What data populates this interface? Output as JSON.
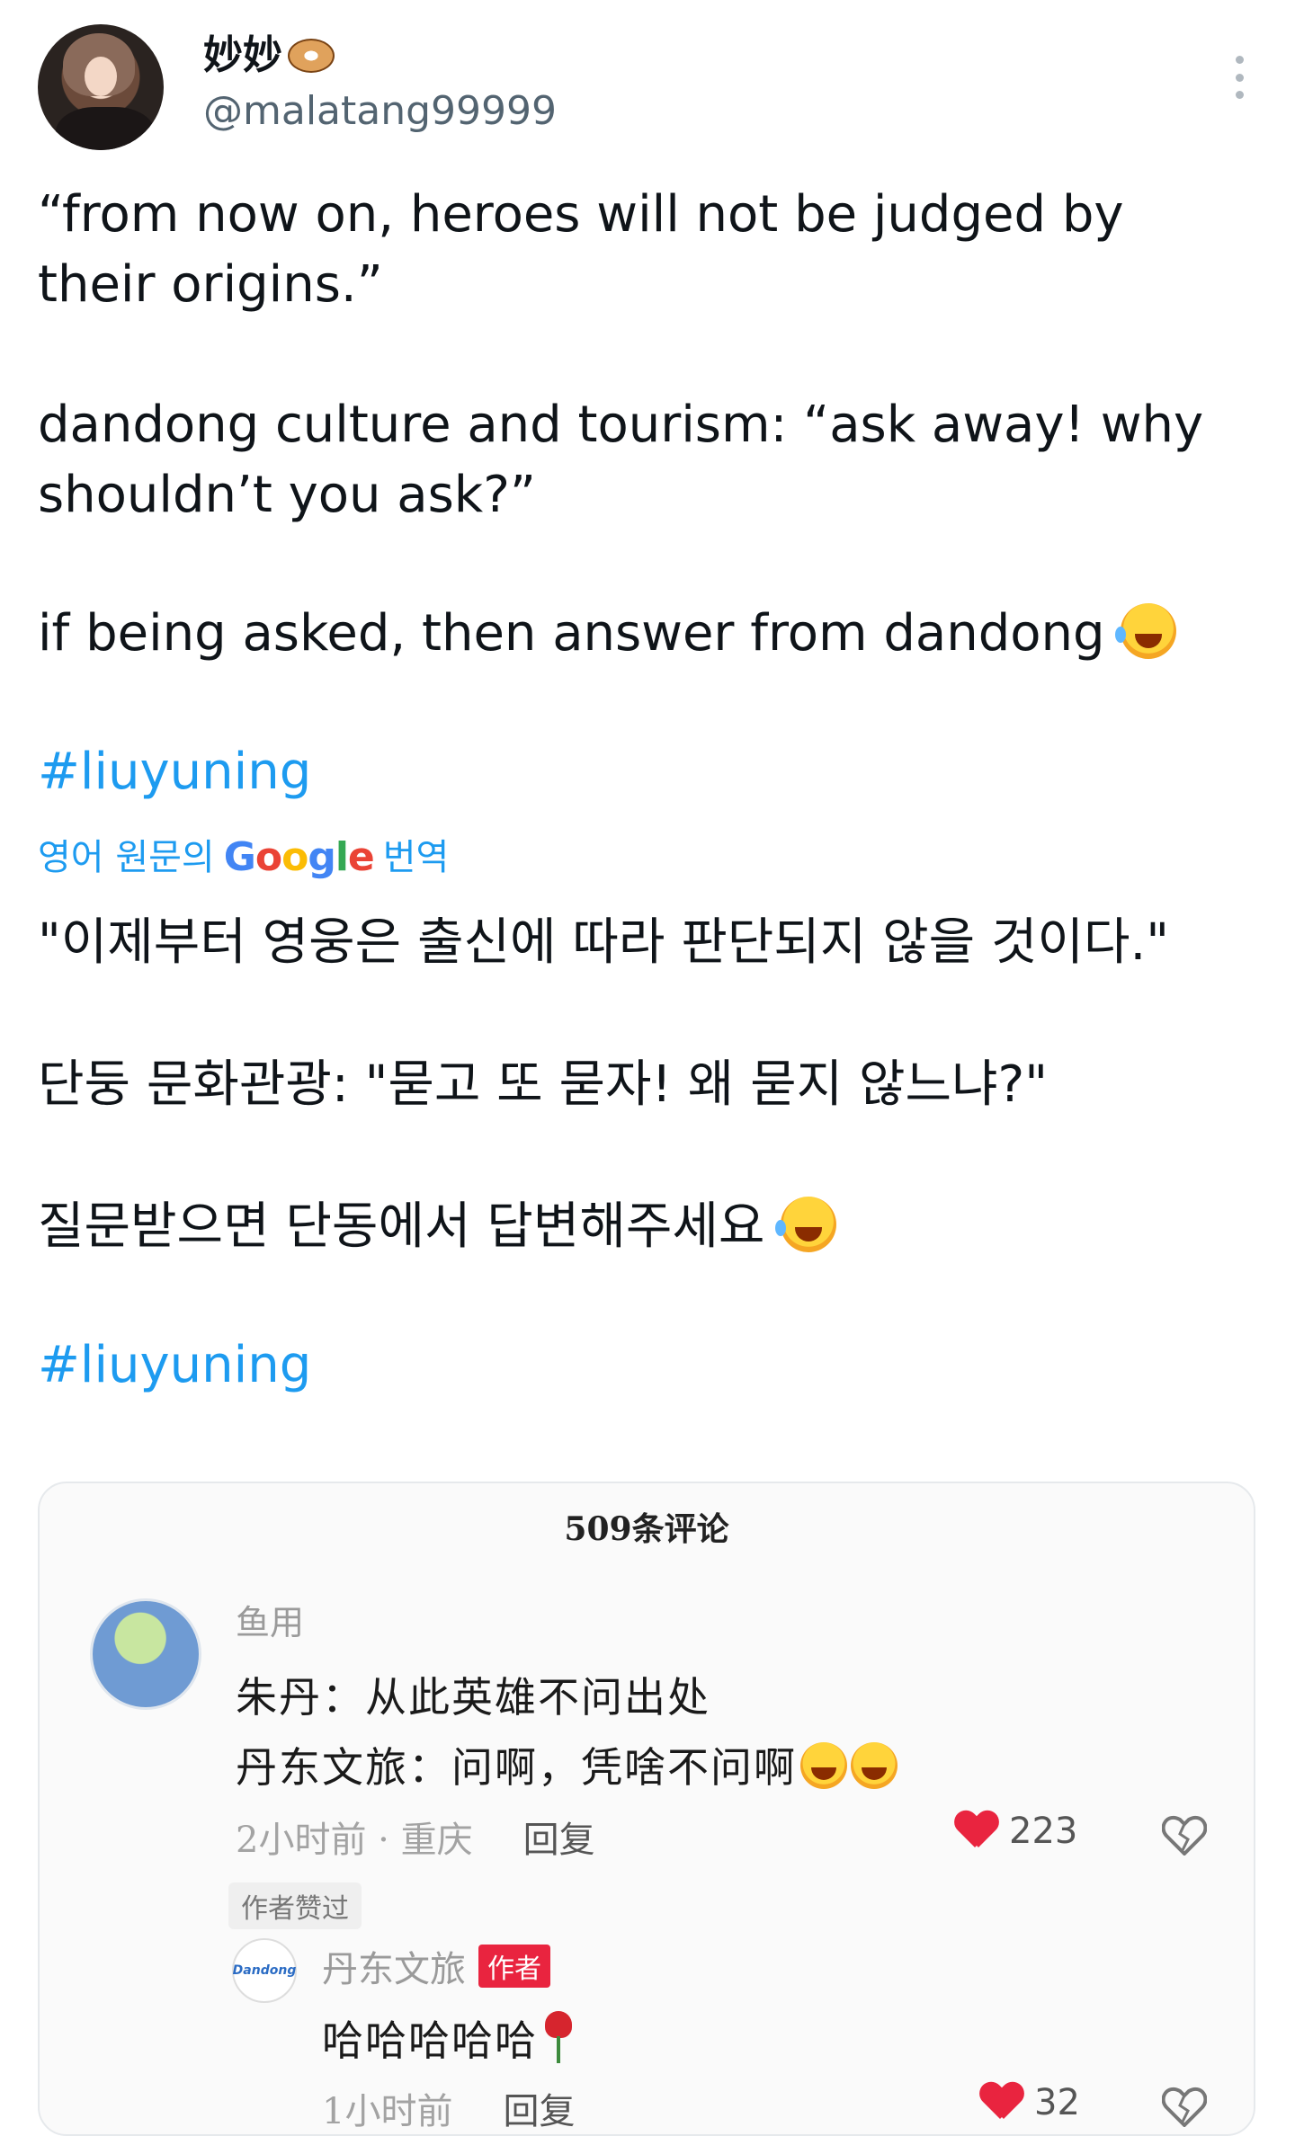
{
  "tweet": {
    "display_name": "妙妙",
    "name_emoji": "donut-icon",
    "handle": "@malatang99999",
    "text_1": "“from now on, heroes will not be judged by their origins.”",
    "text_2": "dandong culture and tourism: “ask away! why shouldn’t you ask?”",
    "text_3": "if being asked, then answer from dandong",
    "hashtag": "#liuyuning",
    "translation_prefix": "영어 원문의",
    "translation_suffix": "번역",
    "translated_1": "\"이제부터 영웅은 출신에 따라 판단되지 않을 것이다.\"",
    "translated_2": "단둥 문화관광: \"묻고 또 묻자! 왜 묻지 않느냐?\"",
    "translated_3": "질문받으면 단동에서 답변해주세요",
    "translated_hashtag": "#liuyuning"
  },
  "media": {
    "title": "509条评论",
    "comment": {
      "author": "鱼用",
      "line_1": "朱丹：从此英雄不问出处",
      "line_2": "丹东文旅：问啊，凭啥不问啊",
      "time": "2小时前",
      "location": "· 重庆",
      "reply": "回复",
      "likes": "223",
      "liked_badge": "作者赞过"
    },
    "reply": {
      "avatar_text": "Dandong",
      "author": "丹东文旅",
      "author_badge": "作者",
      "text": "哈哈哈哈哈",
      "time": "1小时前",
      "reply": "回复",
      "likes": "32"
    }
  },
  "colors": {
    "link": "#1d9bf0",
    "heart": "#e9243f",
    "muted": "#536471"
  }
}
